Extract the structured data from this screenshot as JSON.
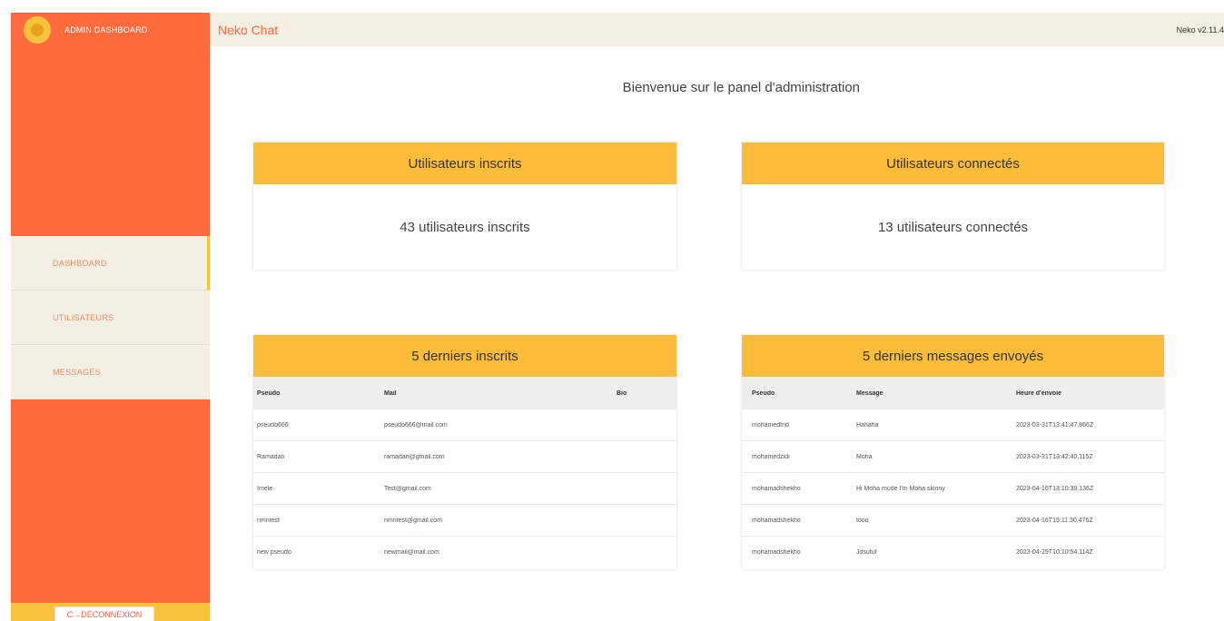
{
  "sidebar": {
    "brand_title": "ADMIN DASHBOARD",
    "items": [
      {
        "label": "DASHBOARD"
      },
      {
        "label": "UTILISATEURS"
      },
      {
        "label": "MESSAGES"
      }
    ],
    "logout_label": "C→DÉCONNEXION"
  },
  "topbar": {
    "app_name": "Neko Chat",
    "version": "Neko v2.11.4"
  },
  "welcome": "Bienvenue sur le panel d'administration",
  "stats": {
    "registered": {
      "title": "Utilisateurs inscrits",
      "text": "43 utilisateurs inscrits"
    },
    "connected": {
      "title": "Utilisateurs connectés",
      "text": "13 utilisateurs connectés"
    }
  },
  "latest_users": {
    "title": "5 derniers inscrits",
    "headers": [
      "Pseudo",
      "Mail",
      "Bio"
    ],
    "rows": [
      [
        "pseudo666",
        "pseudo666@mail.com",
        ""
      ],
      [
        "Ramadan",
        "ramadan@gmail.com",
        ""
      ],
      [
        "Imele",
        "Test@gmail.com",
        ""
      ],
      [
        "nmntest",
        "nmntest@gmail.com",
        ""
      ],
      [
        "new pseudo",
        "newmail@mail.com",
        ""
      ]
    ]
  },
  "latest_messages": {
    "title": "5 derniers messages envoyés",
    "headers": [
      "Pseudo",
      "Message",
      "Heure d'envoie"
    ],
    "rows": [
      [
        "mohamedtrid",
        "Hahaha",
        "2023-03-31T13:41:47.866Z"
      ],
      [
        "mohamedzidi",
        "Moha",
        "2023-03-31T13:42:40.115Z"
      ],
      [
        "mohamadshekho",
        "Hi Moha mude I'm Moha skinny",
        "2023-04-16T13:10:39.136Z"
      ],
      [
        "mohamadshekho",
        "tooo",
        "2023-04-16T15:11:30.476Z"
      ],
      [
        "mohamadshekho",
        "Jdsufuf",
        "2023-04-29T10:10:54.114Z"
      ]
    ]
  }
}
